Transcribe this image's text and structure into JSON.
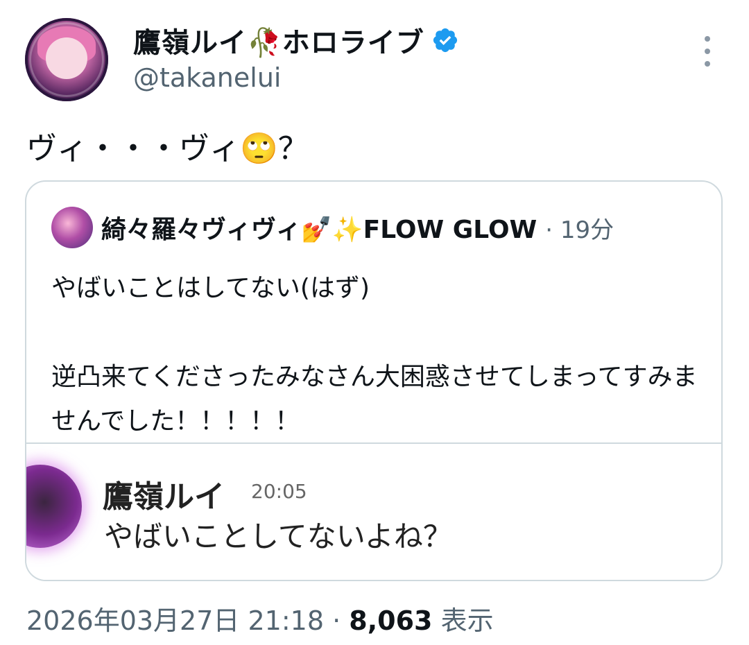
{
  "tweet": {
    "author": {
      "display_name": "鷹嶺ルイ🥀ホロライブ",
      "handle": "@takanelui",
      "verified": true
    },
    "text": "ヴィ・・・ヴィ🙄？",
    "timestamp": "2026年03月27日 21:18",
    "separator": "·",
    "views_count": "8,063",
    "views_label": "表示"
  },
  "quoted_tweet": {
    "author": {
      "display_name": "綺々羅々ヴィヴィ💅✨FLOW GLOW"
    },
    "time": "· 19分",
    "body": "やばいことはしてない(はず)\n\n逆凸来てくださったみなさん大困惑させてしまってすみませんでした！！！！！",
    "embedded_chat": {
      "name": "鷹嶺ルイ",
      "time": "20:05",
      "message": "やばいことしてないよね？"
    }
  },
  "colors": {
    "text_primary": "#0f1419",
    "text_secondary": "#536471",
    "border": "#cfd9de",
    "verified_blue": "#1d9bf0"
  },
  "icons": [
    "verified-badge-icon",
    "more-options-icon",
    "eye-roll-emoji-icon",
    "nail-polish-emoji-icon",
    "sparkles-emoji-icon"
  ]
}
